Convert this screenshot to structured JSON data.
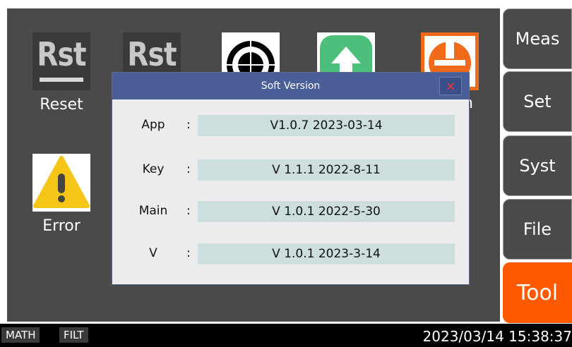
{
  "tools": [
    {
      "label": "Reset",
      "tile_text": "Rst",
      "icon": "rst-icon"
    },
    {
      "label": "",
      "tile_text": "Rst",
      "icon": "rst-icon"
    },
    {
      "label": "",
      "icon": "target-icon"
    },
    {
      "label": "",
      "icon": "upload-arrow-icon"
    },
    {
      "label": "on",
      "icon": "power-icon"
    },
    {
      "label": "Error",
      "icon": "warning-icon"
    }
  ],
  "menu": [
    {
      "label": "Meas",
      "active": false
    },
    {
      "label": "Set",
      "active": false
    },
    {
      "label": "Syst",
      "active": false
    },
    {
      "label": "File",
      "active": false
    },
    {
      "label": "Tool",
      "active": true
    }
  ],
  "dialog": {
    "title": "Soft Version",
    "close_label": "×",
    "rows": [
      {
        "label": "App",
        "colon": ":",
        "value": "V1.0.7 2023-03-14"
      },
      {
        "label": "Key",
        "colon": ":",
        "value": "V 1.1.1 2022-8-11"
      },
      {
        "label": "Main",
        "colon": ":",
        "value": "V 1.0.1 2022-5-30"
      },
      {
        "label": "V",
        "colon": ":",
        "value": "V 1.0.1 2023-3-14"
      }
    ]
  },
  "status": {
    "tags": [
      "MATH",
      "FILT"
    ],
    "datetime": "2023/03/14 15:38:37"
  },
  "colors": {
    "active_menu": "#ff5a00",
    "dialog_title_bar": "#4a5f98",
    "value_field": "#ccdedd",
    "screen_bg": "#4a4a4a"
  }
}
